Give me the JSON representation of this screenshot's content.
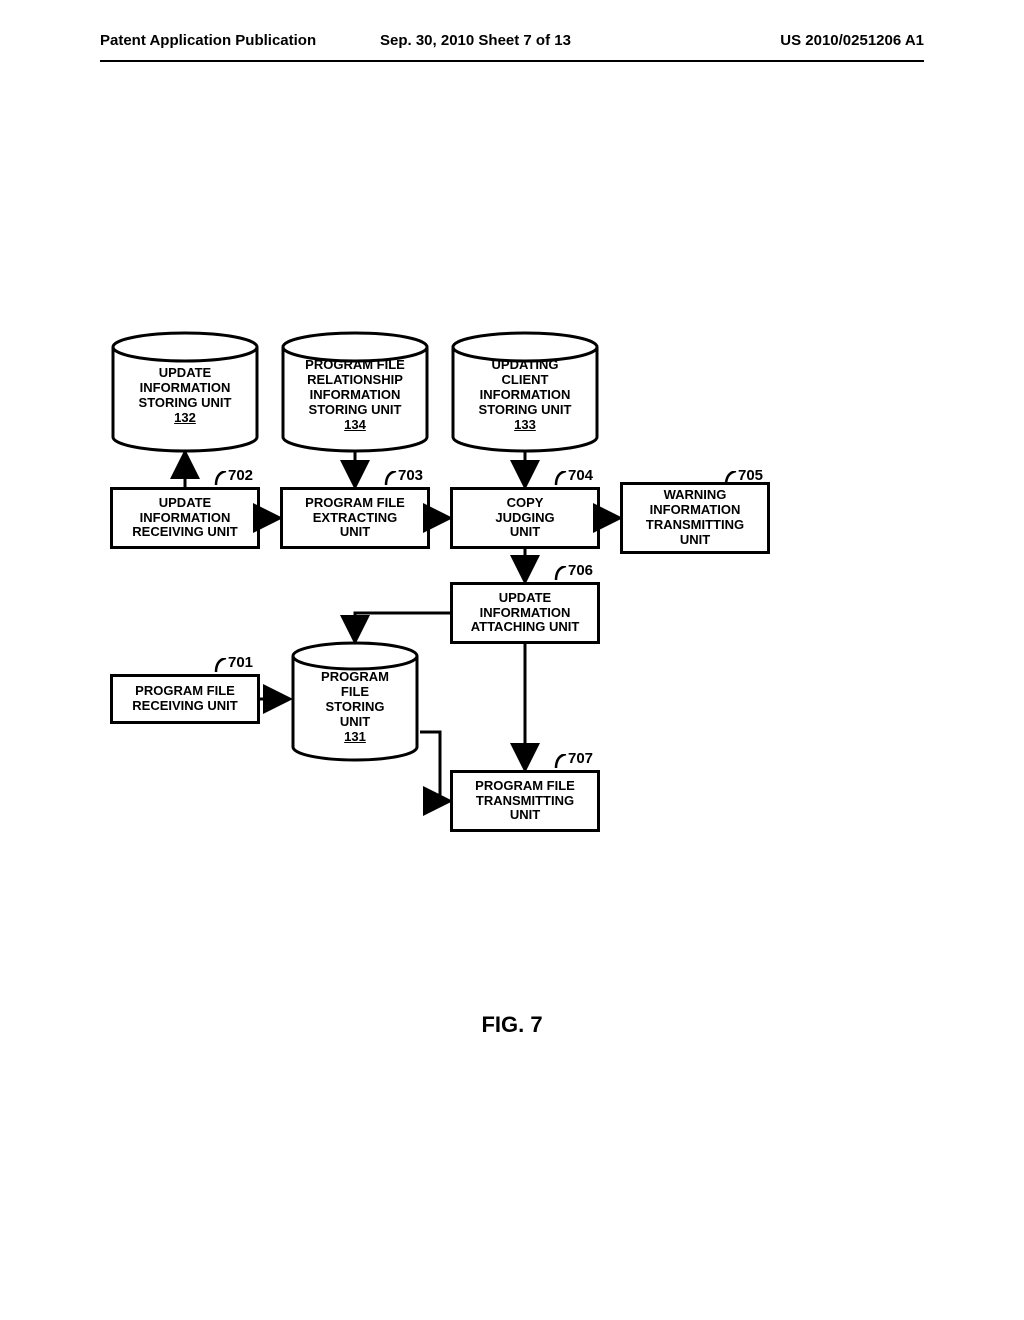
{
  "header": {
    "left": "Patent Application Publication",
    "center": "Sep. 30, 2010  Sheet 7 of 13",
    "right": "US 2010/0251206 A1"
  },
  "cylinders": {
    "c132": {
      "l1": "UPDATE",
      "l2": "INFORMATION",
      "l3": "STORING UNIT",
      "num": "132"
    },
    "c134": {
      "l1": "PROGRAM FILE",
      "l2": "RELATIONSHIP",
      "l3": "INFORMATION",
      "l4": "STORING UNIT",
      "num": "134"
    },
    "c133": {
      "l1": "UPDATING",
      "l2": "CLIENT",
      "l3": "INFORMATION",
      "l4": "STORING UNIT",
      "num": "133"
    },
    "c131": {
      "l1": "PROGRAM",
      "l2": "FILE",
      "l3": "STORING",
      "l4": "UNIT",
      "num": "131"
    }
  },
  "boxes": {
    "b702": {
      "l1": "UPDATE",
      "l2": "INFORMATION",
      "l3": "RECEIVING UNIT"
    },
    "b703": {
      "l1": "PROGRAM FILE",
      "l2": "EXTRACTING",
      "l3": "UNIT"
    },
    "b704": {
      "l1": "COPY",
      "l2": "JUDGING",
      "l3": "UNIT"
    },
    "b705": {
      "l1": "WARNING",
      "l2": "INFORMATION",
      "l3": "TRANSMITTING",
      "l4": "UNIT"
    },
    "b706": {
      "l1": "UPDATE",
      "l2": "INFORMATION",
      "l3": "ATTACHING UNIT"
    },
    "b701": {
      "l1": "PROGRAM FILE",
      "l2": "RECEIVING UNIT"
    },
    "b707": {
      "l1": "PROGRAM FILE",
      "l2": "TRANSMITTING",
      "l3": "UNIT"
    }
  },
  "refs": {
    "r702": "702",
    "r703": "703",
    "r704": "704",
    "r705": "705",
    "r706": "706",
    "r701": "701",
    "r707": "707"
  },
  "caption": "FIG. 7"
}
